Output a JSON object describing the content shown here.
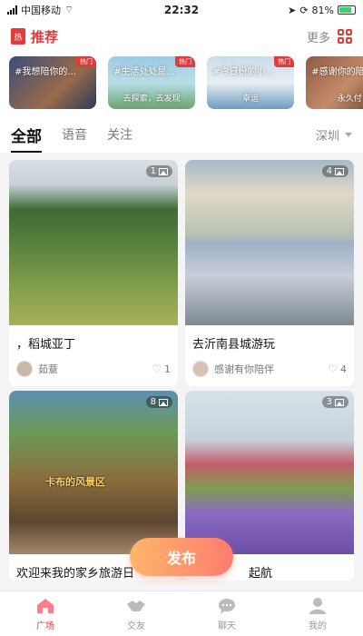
{
  "status": {
    "carrier": "中国移动",
    "time": "22:32",
    "battery": "81%"
  },
  "header": {
    "badge": "热",
    "title": "推荐",
    "more": "更多"
  },
  "topics": [
    {
      "title": "#我想陪你的...",
      "sub": "",
      "tag": "热门"
    },
    {
      "title": "#生活处处是...",
      "sub": "去探索，去发现",
      "tag": "热门"
    },
    {
      "title": "#今日份的小...",
      "sub": "幸运",
      "tag": "热门"
    },
    {
      "title": "#感谢你的陪伴",
      "sub": "永久付",
      "tag": ""
    }
  ],
  "tabs": {
    "items": [
      "全部",
      "语音",
      "关注"
    ],
    "city": "深圳"
  },
  "posts": [
    {
      "title": "，稻城亚丁",
      "author": "茹薏",
      "likes": "1",
      "images": "1"
    },
    {
      "title": "去沂南县城游玩",
      "author": "感谢有你陪伴",
      "likes": "4",
      "images": "4"
    },
    {
      "title": "欢迎来我的家乡旅游日",
      "author": "",
      "likes": "",
      "images": "8",
      "sign": "卡布的风景区"
    },
    {
      "title": "起航",
      "author": "",
      "likes": "",
      "images": "3"
    }
  ],
  "publish": "发布",
  "nav": [
    {
      "label": "广场",
      "icon": "home-icon"
    },
    {
      "label": "交友",
      "icon": "handshake-icon"
    },
    {
      "label": "聊天",
      "icon": "chat-icon"
    },
    {
      "label": "我的",
      "icon": "user-icon"
    }
  ],
  "colors": {
    "accent": "#e33a3a",
    "publish_start": "#ffb56b",
    "publish_end": "#ff7c6e"
  }
}
